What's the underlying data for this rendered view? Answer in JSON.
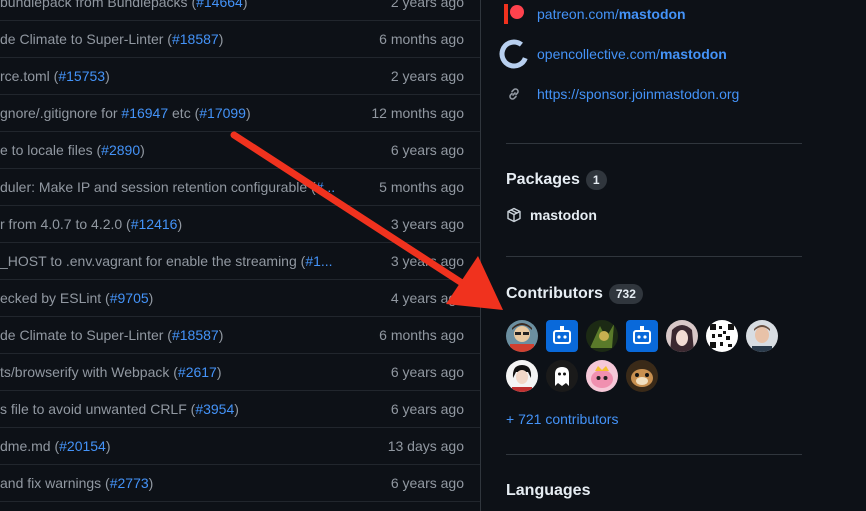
{
  "commits": [
    {
      "text": "bundlepack from Bundlepacks (",
      "pr": "#14664",
      "tail": ")",
      "age": "2 years ago"
    },
    {
      "text": "de Climate to Super-Linter (",
      "pr": "#18587",
      "tail": ")",
      "age": "6 months ago"
    },
    {
      "text": "rce.toml (",
      "pr": "#15753",
      "tail": ")",
      "age": "2 years ago"
    },
    {
      "text": "gnore/.gitignore for ",
      "pr": "#16947",
      "tail": " etc (",
      "pr2": "#17099",
      "tail2": ")",
      "age": "12 months ago"
    },
    {
      "text": "e to locale files (",
      "pr": "#2890",
      "tail": ")",
      "age": "6 years ago"
    },
    {
      "text": "duler: Make IP and session retention configurable (",
      "pr": "#...",
      "tail": "",
      "age": "5 months ago"
    },
    {
      "text": "r from 4.0.7 to 4.2.0 (",
      "pr": "#12416",
      "tail": ")",
      "age": "3 years ago"
    },
    {
      "text": "_HOST to .env.vagrant for enable the streaming (",
      "pr": "#1...",
      "tail": "",
      "age": "3 years ago"
    },
    {
      "text": "ecked by ESLint (",
      "pr": "#9705",
      "tail": ")",
      "age": "4 years ago"
    },
    {
      "text": "de Climate to Super-Linter (",
      "pr": "#18587",
      "tail": ")",
      "age": "6 months ago"
    },
    {
      "text": "ts/browserify with Webpack (",
      "pr": "#2617",
      "tail": ")",
      "age": "6 years ago"
    },
    {
      "text": "s file to avoid unwanted CRLF (",
      "pr": "#3954",
      "tail": ")",
      "age": "6 years ago"
    },
    {
      "text": "dme.md (",
      "pr": "#20154",
      "tail": ")",
      "age": "13 days ago"
    },
    {
      "text": "and fix warnings (",
      "pr": "#2773",
      "tail": ")",
      "age": "6 years ago"
    }
  ],
  "sponsors": [
    {
      "prefix": "patreon.com/",
      "bold": "mastodon",
      "icon": "patreon-icon"
    },
    {
      "prefix": "opencollective.com/",
      "bold": "mastodon",
      "icon": "opencollective-icon"
    },
    {
      "prefix": "https://sponsor.joinmastodon.org",
      "bold": "",
      "icon": "link-icon"
    }
  ],
  "packages": {
    "title": "Packages",
    "count": "1",
    "name": "mastodon"
  },
  "contributors": {
    "title": "Contributors",
    "count": "732",
    "more": "+ 721 contributors"
  },
  "languages": {
    "title": "Languages"
  },
  "colors": {
    "link": "#4493f8",
    "muted": "#9198a1",
    "bg": "#0d1117",
    "arrow": "#f0321e",
    "border": "#30363d"
  }
}
